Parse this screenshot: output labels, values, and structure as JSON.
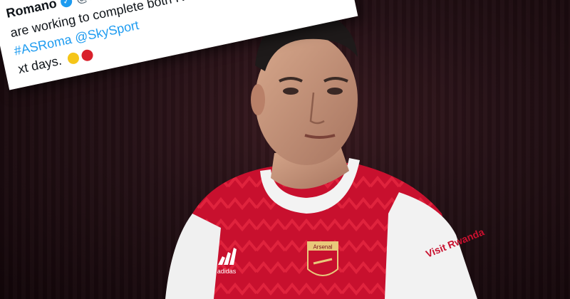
{
  "tweet": {
    "name": "Romano",
    "handle": "@FabrizioRomano",
    "line1": "are working to complete both Rui Patricio and",
    "line2_tags": [
      "#ASRoma",
      "@SkySport"
    ],
    "line3": "xt days."
  },
  "shirt": {
    "crest_text": "Arsenal",
    "sponsor_text": "Visit Rwanda",
    "brand_text": "adidas"
  },
  "colors": {
    "shirt_red": "#c8102e",
    "sleeve_white": "#f2f2f2",
    "background": "#241015"
  }
}
